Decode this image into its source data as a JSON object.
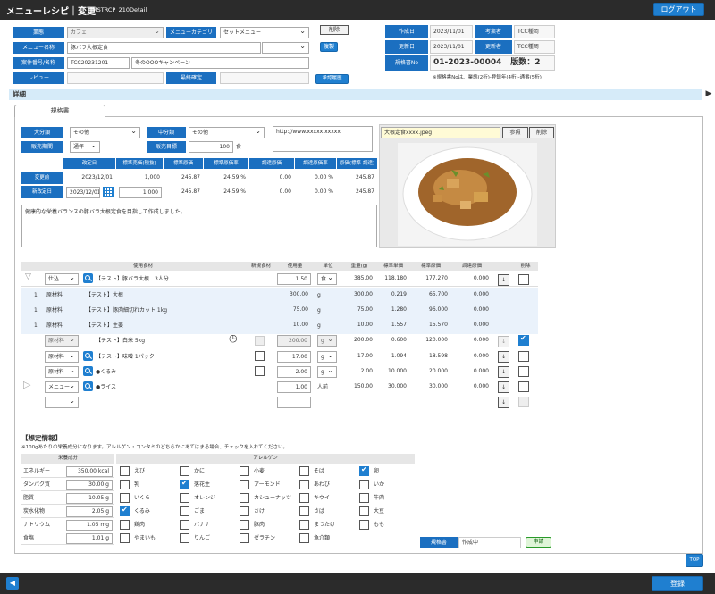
{
  "header": {
    "title": "メニューレシピ｜変更",
    "screen_id": "MSTRCP_210Detail",
    "logout": "ログアウト"
  },
  "top_form": {
    "business_label": "業態",
    "business_value": "カフェ",
    "menu_category_label": "メニューカテゴリ",
    "menu_category_value": "セットメニュー",
    "delete_label": "削除",
    "menu_name_label": "メニュー名称",
    "menu_name_value": "豚バラ大根定食",
    "copy_label": "複製",
    "case_label": "案件番号/名称",
    "case_no": "TCC20231201",
    "case_name": "冬のOOOキャンペーン",
    "review_label": "レビュー",
    "final_label": "最終確定",
    "approval_label": "承認履歴"
  },
  "info": {
    "created_label": "作成日",
    "created": "2023/11/01",
    "planner_label": "考案者",
    "planner": "TCC種岡",
    "updated_label": "更新日",
    "updated": "2023/11/01",
    "updater_label": "更新者",
    "updater": "TCC種岡",
    "spec_no_label": "規格書No",
    "spec_no": "01-2023-00004",
    "edition": "版数：2",
    "note": "※規格書Noは、業態(2桁)-登録年(4桁)-通番(5桁)"
  },
  "section_title": "詳細",
  "tab_label": "規格書",
  "detail": {
    "major_label": "大分類",
    "major_value": "その他",
    "mid_label": "中分類",
    "mid_value": "その他",
    "period_label": "販売期間",
    "period_value": "通年",
    "target_label": "販売目標",
    "target_value": "100",
    "target_unit": "食",
    "url": "http://www.xxxxx.xxxxx",
    "image_file": "大根定食xxxx.jpeg",
    "ref_btn": "参照",
    "del_btn": "削除",
    "description": "健康的な栄養バランスの豚バラ大根定食を目指して作成しました。"
  },
  "price_table": {
    "headers": [
      "改定日",
      "標準売価(税抜)",
      "標準原価",
      "標準原価率",
      "調達原価",
      "調達原価率",
      "原価(標準-調達)"
    ],
    "rows": [
      {
        "label": "変更前",
        "cells": [
          "2023/12/01",
          "1,000",
          "245.87",
          "24.59 %",
          "0.00",
          "0.00 %",
          "245.87"
        ]
      },
      {
        "label": "新改定日",
        "cells": [
          "2023/12/01",
          "1,000",
          "245.87",
          "24.59 %",
          "0.00",
          "0.00 %",
          "245.87"
        ]
      }
    ]
  },
  "ingredients": {
    "headers": [
      "使用食材",
      "新規食材",
      "使用量",
      "単位",
      "重量(g)",
      "標準単価",
      "標準原価",
      "調達原価",
      "削除"
    ],
    "rows": [
      {
        "type": "仕込",
        "name": "【テスト】豚バラ大根　3人分",
        "qty": "1.50",
        "unit": "食",
        "weight": "385.00",
        "unit_price": "118.180",
        "std_cost": "177.270",
        "proc_cost": "0.000"
      },
      {
        "type": "原材料",
        "name": "【テスト】大根",
        "qty": "300.00",
        "unit": "g",
        "weight": "300.00",
        "unit_price": "0.219",
        "std_cost": "65.700",
        "proc_cost": "0.000"
      },
      {
        "type": "原材料",
        "name": "【テスト】豚肉細切れカット 1kg",
        "qty": "75.00",
        "unit": "g",
        "weight": "75.00",
        "unit_price": "1.280",
        "std_cost": "96.000",
        "proc_cost": "0.000"
      },
      {
        "type": "原材料",
        "name": "【テスト】生姜",
        "qty": "10.00",
        "unit": "g",
        "weight": "10.00",
        "unit_price": "1.557",
        "std_cost": "15.570",
        "proc_cost": "0.000"
      },
      {
        "type": "原材料",
        "name": "【テスト】白米 5kg",
        "qty": "200.00",
        "unit": "g",
        "weight": "200.00",
        "unit_price": "0.600",
        "std_cost": "120.000",
        "proc_cost": "0.000"
      },
      {
        "type": "原材料",
        "name": "【テスト】味噌 1パック",
        "qty": "17.00",
        "unit": "g",
        "weight": "17.00",
        "unit_price": "1.094",
        "std_cost": "18.598",
        "proc_cost": "0.000"
      },
      {
        "type": "原材料",
        "name": "●くるみ",
        "qty": "2.00",
        "unit": "g",
        "weight": "2.00",
        "unit_price": "10.000",
        "std_cost": "20.000",
        "proc_cost": "0.000"
      },
      {
        "type": "メニュー",
        "name": "●ライス",
        "qty": "1.00",
        "unit": "人前",
        "weight": "150.00",
        "unit_price": "30.000",
        "std_cost": "30.000",
        "proc_cost": "0.000"
      }
    ],
    "sub_marks": [
      "1",
      "1",
      "1"
    ]
  },
  "assumed": {
    "title": "【想定情報】",
    "note": "※100gあたりの栄養成分になります。アレルゲン・コンタミのどちらかにあてはまる場合、チェックを入れてください。",
    "nutrition_header": "栄養成分",
    "allergen_header": "アレルゲン",
    "nutrition": [
      {
        "name": "エネルギー",
        "value": "350.00 kcal"
      },
      {
        "name": "タンパク質",
        "value": "30.00 g"
      },
      {
        "name": "脂質",
        "value": "10.05 g"
      },
      {
        "name": "炭水化物",
        "value": "2.05 g"
      },
      {
        "name": "ナトリウム",
        "value": "1.05 mg"
      },
      {
        "name": "食塩",
        "value": "1.01 g"
      }
    ],
    "allergens": [
      [
        "えび",
        "かに",
        "小麦",
        "そば",
        "卵"
      ],
      [
        "乳",
        "落花生",
        "アーモンド",
        "あわび",
        "いか"
      ],
      [
        "いくら",
        "オレンジ",
        "カシューナッツ",
        "キウイ",
        "牛肉"
      ],
      [
        "くるみ",
        "ごま",
        "さけ",
        "さば",
        "大豆"
      ],
      [
        "鶏肉",
        "バナナ",
        "豚肉",
        "まつたけ",
        "もも"
      ],
      [
        "やまいも",
        "りんご",
        "ゼラチン",
        "魚介類",
        ""
      ]
    ],
    "status_label": "規格書",
    "status_value": "作成中",
    "apply_btn": "申請"
  },
  "footer": {
    "top": "TOP",
    "register": "登録"
  },
  "colors": {
    "accent": "#1f7fd0",
    "header": "#2b2b2b",
    "section": "#d6ebf9"
  }
}
